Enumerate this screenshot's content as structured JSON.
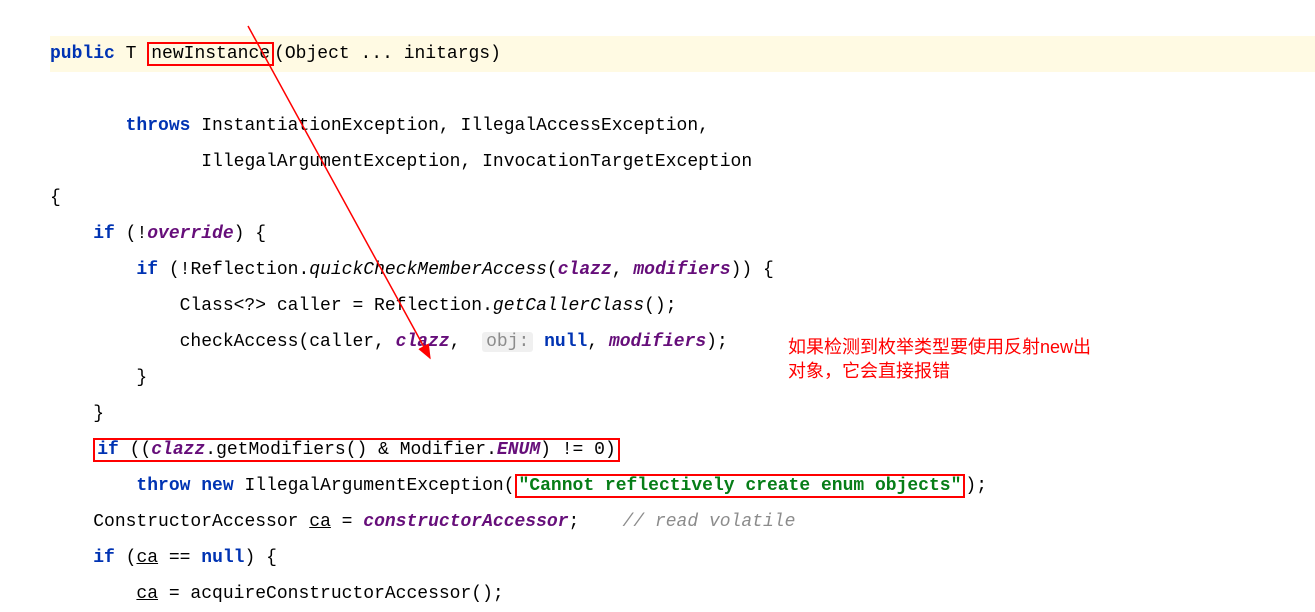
{
  "code": {
    "line1": {
      "kw_public": "public",
      "type_T": "T",
      "method": "newInstance",
      "params": "(Object ... initargs)"
    },
    "line2": {
      "kw_throws": "throws",
      "ex1": "InstantiationException,",
      "ex2": "IllegalAccessException,"
    },
    "line3": {
      "ex3": "IllegalArgumentException,",
      "ex4": "InvocationTargetException"
    },
    "line4": "{",
    "line5": {
      "kw_if": "if",
      "open": "(!",
      "field": "override",
      "close": ") {"
    },
    "line6": {
      "kw_if": "if",
      "open": "(!Reflection.",
      "call": "quickCheckMemberAccess",
      "mid": "(",
      "arg1": "clazz",
      "comma": ", ",
      "arg2": "modifiers",
      "close": ")) {"
    },
    "line7": {
      "txt": "Class<?> caller = Reflection.",
      "call": "getCallerClass",
      "close": "();"
    },
    "line8": {
      "call": "checkAccess(caller, ",
      "arg1": "clazz",
      "hint": "obj:",
      "kw_null": "null",
      "comma": ", ",
      "arg2": "modifiers",
      "close": ");"
    },
    "line9": "}",
    "line10": "}",
    "line11": {
      "kw_if": "if",
      "open": "((",
      "field1": "clazz",
      "txt1": ".getModifiers() & Modifier.",
      "enum": "ENUM",
      "txt2": ") != 0)"
    },
    "line12": {
      "kw_throw": "throw",
      "kw_new": "new",
      "txt": "IllegalArgumentException(",
      "string": "\"Cannot reflectively create enum objects\"",
      "close": ");"
    },
    "line13": {
      "txt1": "ConstructorAccessor ",
      "var": "ca",
      "eq": " = ",
      "field": "constructorAccessor",
      "semi": ";",
      "comment": "// read volatile"
    },
    "line14": {
      "kw_if": "if",
      "open": "(",
      "var": "ca",
      "eq": " == ",
      "kw_null": "null",
      "close": ") {"
    },
    "line15": {
      "var": "ca",
      "eq": " = acquireConstructorAccessor();"
    }
  },
  "annotation": {
    "line1": "如果检测到枚举类型要使用反射new出",
    "line2": "对象，它会直接报错"
  }
}
